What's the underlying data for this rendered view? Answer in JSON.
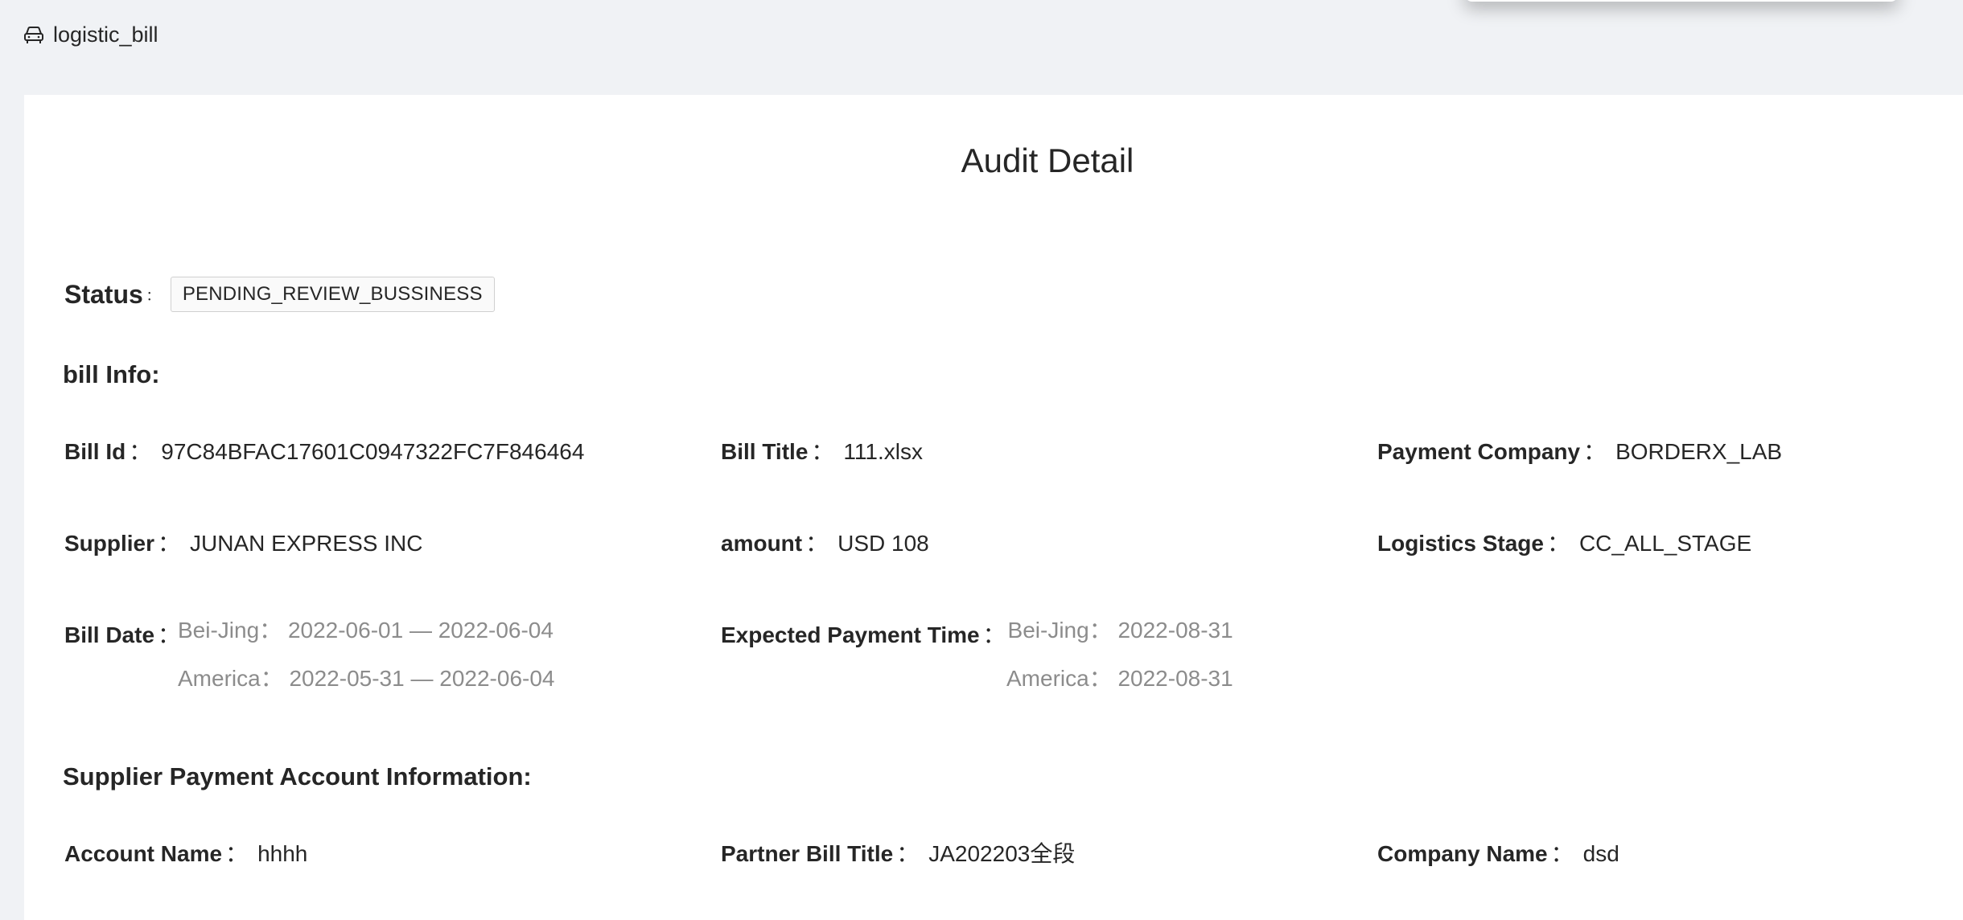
{
  "breadcrumb": {
    "icon": "car-icon",
    "label": "logistic_bill"
  },
  "page": {
    "title": "Audit Detail"
  },
  "status": {
    "label": "Status",
    "value": "PENDING_REVIEW_BUSSINESS"
  },
  "bill_info": {
    "heading": "bill Info:",
    "bill_id": {
      "label": "Bill Id",
      "value": "97C84BFAC17601C0947322FC7F846464"
    },
    "bill_title": {
      "label": "Bill Title",
      "value": "111.xlsx"
    },
    "payment_company": {
      "label": "Payment Company",
      "value": "BORDERX_LAB"
    },
    "supplier": {
      "label": "Supplier",
      "value": "JUNAN EXPRESS INC"
    },
    "amount": {
      "label": "amount",
      "value": "USD 108"
    },
    "logistics_stage": {
      "label": "Logistics Stage",
      "value": "CC_ALL_STAGE"
    },
    "bill_date": {
      "label": "Bill Date",
      "beijing": "Bei-Jing： 2022-06-01 — 2022-06-04",
      "america": "America： 2022-05-31 — 2022-06-04"
    },
    "expected_payment_time": {
      "label": "Expected Payment Time",
      "beijing": "Bei-Jing： 2022-08-31",
      "america": "America： 2022-08-31"
    }
  },
  "supplier_account": {
    "heading": "Supplier Payment Account Information:",
    "account_name": {
      "label": "Account Name",
      "value": "hhhh"
    },
    "partner_bill_title": {
      "label": "Partner Bill Title",
      "value": "JA202203全段"
    },
    "company_name": {
      "label": "Company Name",
      "value": "dsd"
    }
  },
  "colon": "："
}
